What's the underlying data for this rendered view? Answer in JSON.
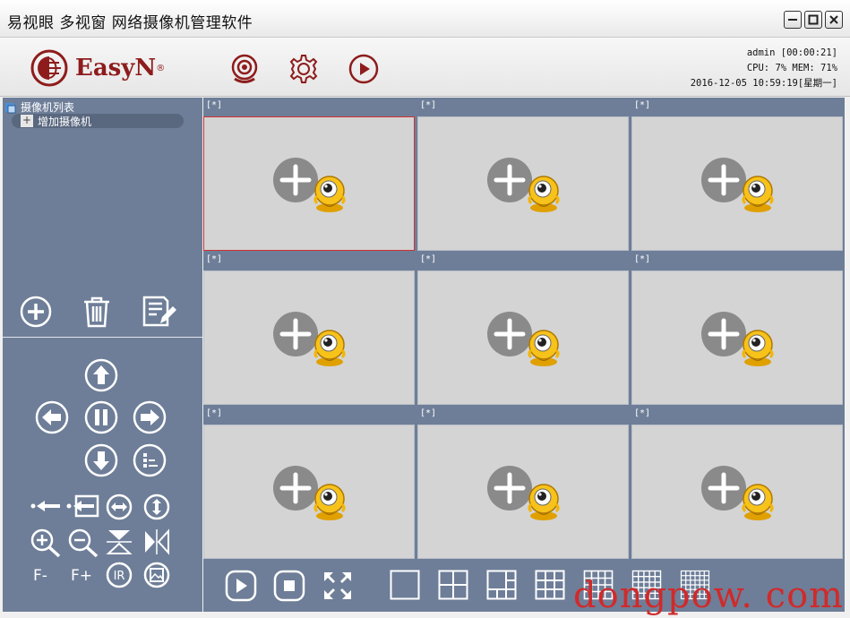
{
  "window": {
    "title": "易视眼 多视窗 网络摄像机管理软件",
    "buttons": [
      "minimize",
      "maximize",
      "close"
    ]
  },
  "header": {
    "logo_text": "EasyN",
    "logo_mark": "®",
    "icons": [
      "camera-icon",
      "gear-icon",
      "play-icon"
    ],
    "status": {
      "user_line": "admin [00:00:21]",
      "resource_line": "CPU:  7%  MEM: 71%",
      "datetime_line": "2016-12-05 10:59:19[星期一]"
    }
  },
  "sidebar": {
    "tree_root": "摄像机列表",
    "tree_items": [
      {
        "label": "增加摄像机"
      }
    ],
    "actions": [
      "add-camera-icon",
      "trash-icon",
      "edit-icon"
    ],
    "ptz": {
      "focus_minus": "F-",
      "focus_plus": "F+",
      "ir": "IR"
    }
  },
  "grid": {
    "cells": [
      {
        "label": "[*]",
        "selected": true
      },
      {
        "label": "[*]",
        "selected": false
      },
      {
        "label": "[*]",
        "selected": false
      },
      {
        "label": "[*]",
        "selected": false
      },
      {
        "label": "[*]",
        "selected": false
      },
      {
        "label": "[*]",
        "selected": false
      },
      {
        "label": "[*]",
        "selected": false
      },
      {
        "label": "[*]",
        "selected": false
      },
      {
        "label": "[*]",
        "selected": false
      }
    ]
  },
  "toolbar": {
    "buttons": [
      "play",
      "stop",
      "fullscreen",
      "layout-1",
      "layout-4",
      "layout-6",
      "layout-9",
      "layout-16",
      "layout-25",
      "layout-36"
    ]
  },
  "watermark": "dongpow. com",
  "colors": {
    "panel": "#6e7e98",
    "brand": "#8e1c1c",
    "cell": "#d4d4d4",
    "selected": "#d23232"
  }
}
